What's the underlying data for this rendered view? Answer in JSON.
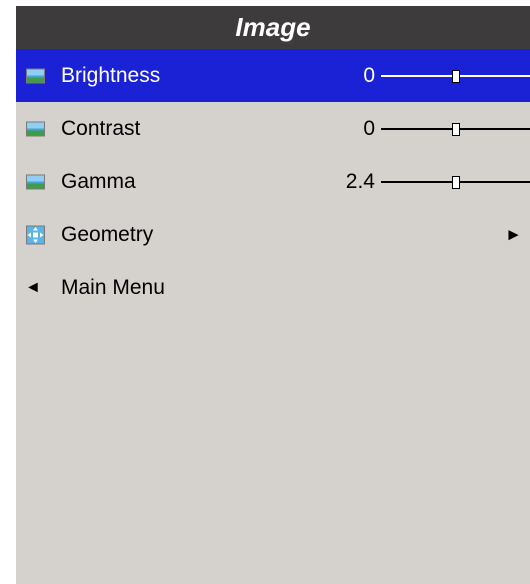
{
  "title": "Image",
  "items": [
    {
      "label": "Brightness",
      "value": "0",
      "level": 0.5,
      "icon": "picture-icon"
    },
    {
      "label": "Contrast",
      "value": "0",
      "level": 0.5,
      "icon": "picture-icon"
    },
    {
      "label": "Gamma",
      "value": "2.4",
      "level": 0.5,
      "icon": "picture-icon"
    },
    {
      "label": "Geometry",
      "icon": "geometry-icon",
      "submenu_glyph": "►"
    }
  ],
  "back": {
    "glyph": "◄",
    "label": "Main Menu"
  },
  "colors": {
    "title_bg": "#3d3b3b",
    "panel_bg": "#d5d1cc",
    "highlight": "#1b22d6"
  }
}
